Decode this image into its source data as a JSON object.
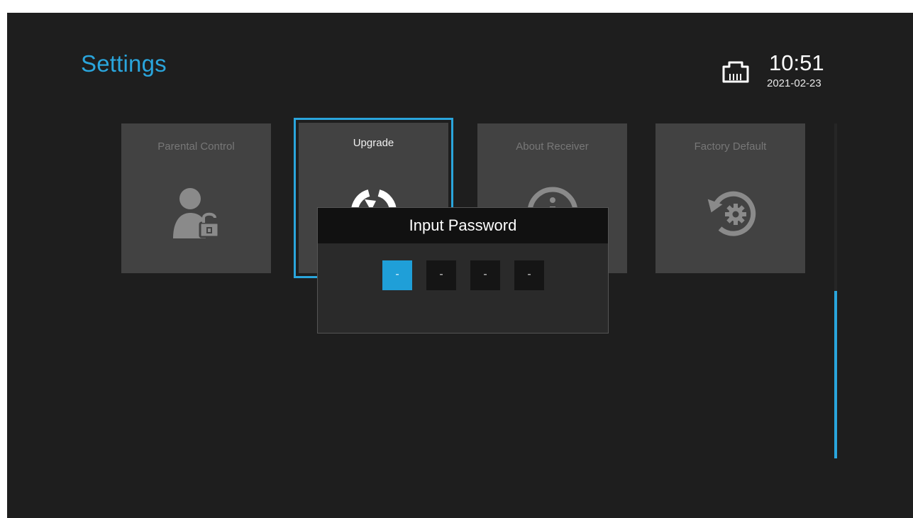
{
  "header": {
    "title": "Settings",
    "time": "10:51",
    "date": "2021-02-23",
    "network_icon": "ethernet-icon"
  },
  "tiles": [
    {
      "label": "Parental Control",
      "icon": "user-lock-icon"
    },
    {
      "label": "Upgrade",
      "icon": "upgrade-icon",
      "selected": true
    },
    {
      "label": "About Receiver",
      "icon": "info-icon"
    },
    {
      "label": "Factory Default",
      "icon": "restore-gear-icon"
    }
  ],
  "dialog": {
    "title": "Input Password",
    "digits": [
      "-",
      "-",
      "-",
      "-"
    ],
    "active_index": 0
  },
  "scrollbar": {
    "position_fraction": 0.5
  },
  "colors": {
    "accent": "#2aa5dc",
    "background": "#1e1e1e",
    "tile": "#424242",
    "dialog_header": "#111111",
    "pin_active": "#1f9fd8"
  }
}
